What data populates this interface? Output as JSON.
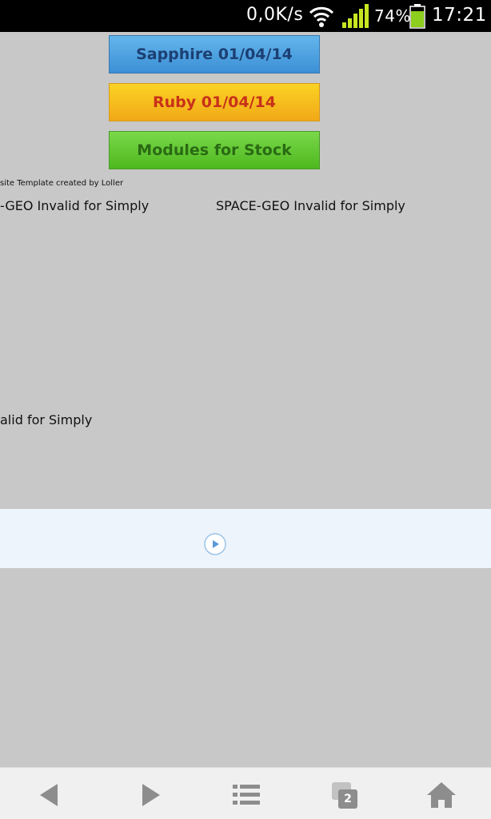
{
  "status_bar": {
    "net_speed": "0,0K/s",
    "battery_percent": "74%",
    "time": "17:21",
    "icons": [
      "wifi-icon",
      "signal-icon",
      "battery-icon"
    ]
  },
  "buttons": {
    "sapphire": "Sapphire 01/04/14",
    "ruby": "Ruby 01/04/14",
    "modules": "Modules for Stock"
  },
  "credit_text": "site Template created by Loller",
  "content": {
    "left_text": "-GEO Invalid for Simply",
    "right_text": "SPACE-GEO Invalid for Simply",
    "lower_text": "alid for Simply"
  },
  "media": {
    "icon": "play-icon"
  },
  "nav_bar": {
    "tab_count": "2",
    "icons": [
      "back-icon",
      "forward-icon",
      "menu-icon",
      "tabs-icon",
      "home-icon"
    ]
  },
  "colors": {
    "sapphire": "#4aa3e2",
    "ruby": "#f5be1f",
    "modules": "#62c934",
    "background": "#c8c8c8"
  }
}
